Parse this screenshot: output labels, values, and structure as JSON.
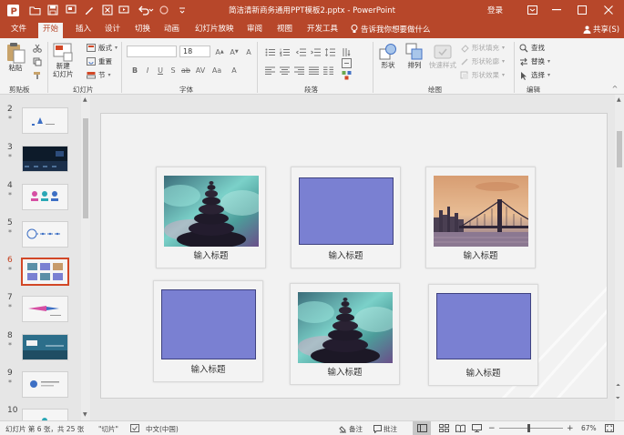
{
  "title_bar": {
    "document_title": "简洁清新商务通用PPT模板2.pptx  -  PowerPoint",
    "login_label": "登录"
  },
  "ribbon_tabs": {
    "items": [
      "文件",
      "开始",
      "插入",
      "设计",
      "切换",
      "动画",
      "幻灯片放映",
      "审阅",
      "视图",
      "开发工具"
    ],
    "active": "开始",
    "tell_me": "告诉我你想要做什么",
    "share": "共享(S)"
  },
  "ribbon": {
    "clipboard": {
      "paste": "粘贴",
      "group": "剪贴板"
    },
    "slides": {
      "new_slide_line1": "新建",
      "new_slide_line2": "幻灯片",
      "layout": "版式",
      "reset": "重置",
      "section": "节",
      "group": "幻灯片"
    },
    "font": {
      "font_size": "18",
      "group": "字体"
    },
    "paragraph": {
      "group": "段落"
    },
    "drawing": {
      "shapes": "形状",
      "arrange": "排列",
      "quick_styles": "快速样式",
      "shape_fill": "形状填充",
      "shape_outline": "形状轮廓",
      "shape_effects": "形状效果",
      "group": "绘图"
    },
    "editing": {
      "find": "查找",
      "replace": "替换",
      "select": "选择",
      "group": "编辑"
    }
  },
  "thumbnails": {
    "slides": [
      {
        "number": "2",
        "mark": "*"
      },
      {
        "number": "3",
        "mark": "*"
      },
      {
        "number": "4",
        "mark": "*"
      },
      {
        "number": "5",
        "mark": "*"
      },
      {
        "number": "6",
        "mark": "*"
      },
      {
        "number": "7",
        "mark": "*"
      },
      {
        "number": "8",
        "mark": "*"
      },
      {
        "number": "9",
        "mark": "*"
      },
      {
        "number": "10",
        "mark": ""
      }
    ],
    "selected": "6"
  },
  "slide": {
    "card_title": "输入标题",
    "cards": [
      {
        "title": "输入标题",
        "media": "zen-stones-image"
      },
      {
        "title": "输入标题",
        "media": "placeholder"
      },
      {
        "title": "输入标题",
        "media": "bridge-skyline-image"
      },
      {
        "title": "输入标题",
        "media": "placeholder"
      },
      {
        "title": "输入标题",
        "media": "zen-stones-image"
      },
      {
        "title": "输入标题",
        "media": "placeholder"
      }
    ]
  },
  "status_bar": {
    "slide_info": "幻灯片 第 6 张，共 25 张",
    "theme": "\"切片\"",
    "language": "中文(中国)",
    "notes": "备注",
    "comments": "批注",
    "zoom": "67%"
  },
  "colors": {
    "accent": "#b7472a",
    "placeholder_fill": "#7a80d2",
    "selected_thumb_border": "#d24726"
  }
}
